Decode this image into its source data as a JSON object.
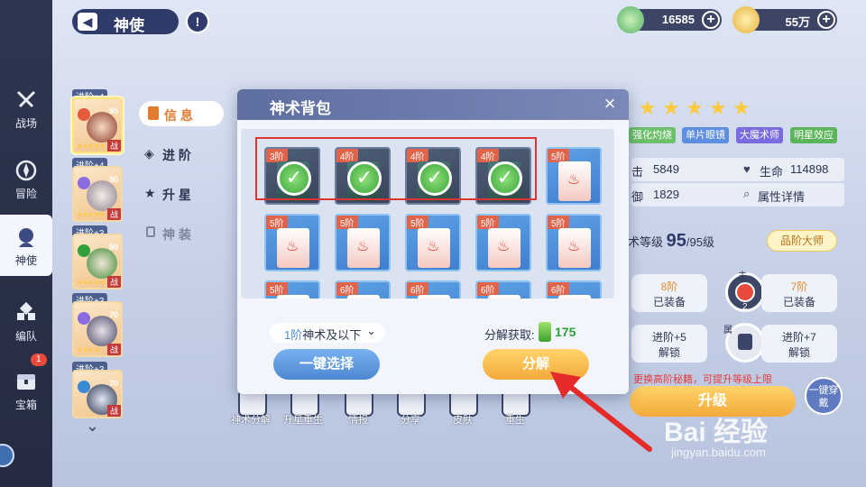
{
  "header": {
    "title": "神使",
    "info": "!"
  },
  "resources": [
    {
      "name": "神术碎片",
      "value": "16585",
      "icon": "crystal-icon",
      "color": "#7fd37a"
    },
    {
      "name": "金币",
      "value": "55万",
      "icon": "coin-icon",
      "color": "#f2c14e"
    }
  ],
  "nav": [
    {
      "label": "战场",
      "icon": "swords-icon"
    },
    {
      "label": "冒险",
      "icon": "compass-icon"
    },
    {
      "label": "神使",
      "icon": "hero-icon",
      "active": true
    },
    {
      "label": "编队",
      "icon": "formation-icon"
    },
    {
      "label": "宝箱",
      "icon": "chest-icon",
      "badge": "1"
    }
  ],
  "roster": [
    {
      "tag": "进阶+4",
      "level": "95",
      "zhan": "战",
      "color": "#e45a3a"
    },
    {
      "tag": "进阶+4",
      "level": "90",
      "zhan": "战",
      "color": "#8a6be0"
    },
    {
      "tag": "进阶+3",
      "level": "90",
      "zhan": "战",
      "color": "#2f9f3a"
    },
    {
      "tag": "进阶+3",
      "level": "70",
      "zhan": "战",
      "color": "#8a6be0"
    },
    {
      "tag": "进阶+3",
      "level": "70",
      "zhan": "战",
      "color": "#3b8ad8"
    }
  ],
  "tabs": [
    {
      "label": "信 息",
      "icon": "book-icon",
      "active": true
    },
    {
      "label": "进 阶",
      "icon": "diamond-icon"
    },
    {
      "label": "升 星",
      "icon": "star-icon"
    },
    {
      "label": "神 装",
      "icon": "lock-icon"
    }
  ],
  "modal": {
    "title": "神术背包",
    "close": "×",
    "cards": [
      {
        "stage": "3阶",
        "owned": true
      },
      {
        "stage": "4阶",
        "owned": true
      },
      {
        "stage": "4阶",
        "owned": true
      },
      {
        "stage": "4阶",
        "owned": true
      },
      {
        "stage": "5阶",
        "owned": false
      },
      {
        "stage": "5阶",
        "owned": false
      },
      {
        "stage": "5阶",
        "owned": false
      },
      {
        "stage": "5阶",
        "owned": false
      },
      {
        "stage": "5阶",
        "owned": false
      },
      {
        "stage": "5阶",
        "owned": false
      },
      {
        "stage": "5阶",
        "owned": false
      },
      {
        "stage": "6阶",
        "owned": false
      },
      {
        "stage": "6阶",
        "owned": false
      },
      {
        "stage": "6阶",
        "owned": false
      },
      {
        "stage": "6阶",
        "owned": false
      }
    ],
    "filter_prefix": "1阶",
    "filter_suffix": "神术及以下",
    "gain_label": "分解获取:",
    "gain_value": "175",
    "select_all": "一键选择",
    "decompose": "分解"
  },
  "details": {
    "traits": [
      "强化灼烧",
      "单片眼镜",
      "大魔术师",
      "明星效应"
    ],
    "trait_colors": [
      "#6cc06a",
      "#5d8ee0",
      "#7a6be0",
      "#5cb55a"
    ],
    "attack_suffix": "击",
    "attack": "5849",
    "hp_label": "生命",
    "hp": "114898",
    "defense_suffix": "御",
    "defense": "1829",
    "attr_detail": "属性详情",
    "level_label": "术等级",
    "level_current": "95",
    "level_max": "/95级",
    "rank_title": "品阶大师",
    "slot1_count": "8阶",
    "slot1_state": "已装备",
    "slot2_count": "7阶",
    "slot2_state": "已装备",
    "slot3_req": "进阶+5",
    "slot3_state": "解锁",
    "slot4_req": "进阶+7",
    "slot4_state": "解锁",
    "circle_top": "主",
    "circle_num": "2",
    "circle_bottom": "属",
    "warning": "更换高阶秘籍，可提升等级上限",
    "upgrade": "升级",
    "wear": "一键穿戴"
  },
  "bottom": [
    {
      "label": "神术分解",
      "icon": "decompose-icon"
    },
    {
      "label": "升星重生",
      "icon": "rebirth-icon"
    },
    {
      "label": "情报",
      "icon": "intel-icon"
    },
    {
      "label": "分享",
      "icon": "share-icon"
    },
    {
      "label": "皮肤",
      "icon": "skin-icon"
    },
    {
      "label": "重生",
      "icon": "reset-icon"
    }
  ],
  "watermark": {
    "text": "Bai 经验",
    "url": "jingyan.baidu.com"
  }
}
